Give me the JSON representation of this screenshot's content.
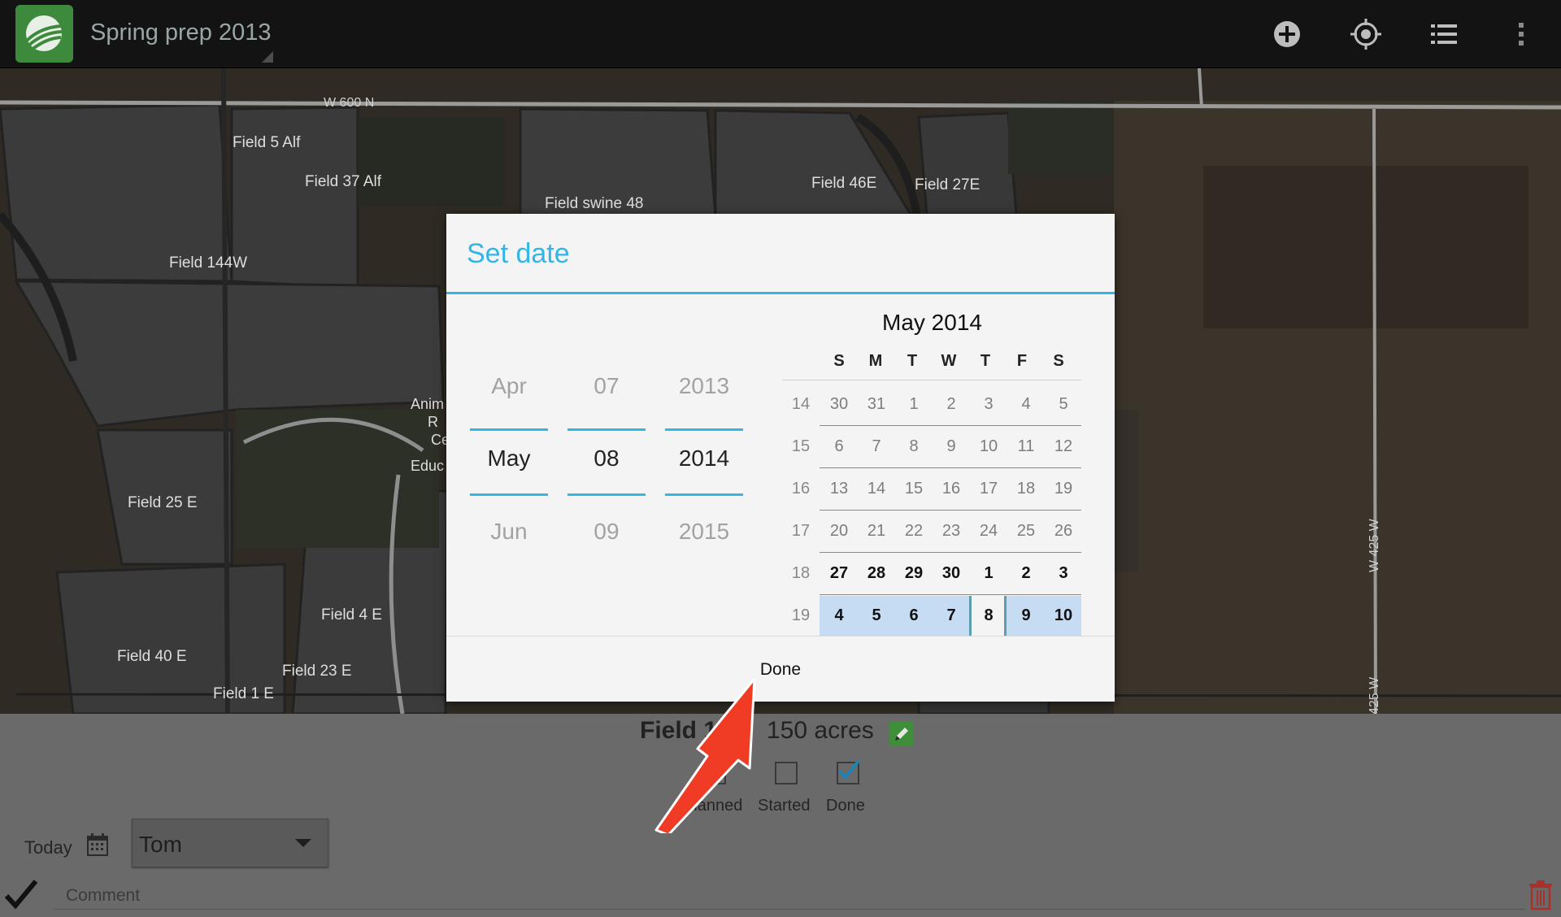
{
  "action_bar": {
    "title": "Spring prep 2013",
    "icons": [
      "logo-icon",
      "add-icon",
      "locate-icon",
      "list-icon",
      "overflow-icon"
    ]
  },
  "map": {
    "road_labels": [
      "W 600 N",
      "W 425 W",
      "425 W"
    ],
    "field_labels": [
      "Field 5 Alf",
      "Field 37 Alf",
      "Field swine 48",
      "Field 46E",
      "Field 27E",
      "Field 144W",
      "Field 25 E",
      "Field 4 E",
      "Field 40 E",
      "Field 23 E",
      "Field 1 E"
    ],
    "other_labels": [
      "Anim",
      "R",
      "Ce",
      "Educ"
    ]
  },
  "dialog": {
    "title": "Set date",
    "spinners": {
      "month": {
        "prev": "Apr",
        "current": "May",
        "next": "Jun"
      },
      "day": {
        "prev": "07",
        "current": "08",
        "next": "09"
      },
      "year": {
        "prev": "2013",
        "current": "2014",
        "next": "2015"
      }
    },
    "calendar": {
      "month_title": "May 2014",
      "weekday_headers": [
        "S",
        "M",
        "T",
        "W",
        "T",
        "F",
        "S"
      ],
      "weeks": [
        {
          "week": "14",
          "days": [
            "30",
            "31",
            "1",
            "2",
            "3",
            "4",
            "5"
          ]
        },
        {
          "week": "15",
          "days": [
            "6",
            "7",
            "8",
            "9",
            "10",
            "11",
            "12"
          ]
        },
        {
          "week": "16",
          "days": [
            "13",
            "14",
            "15",
            "16",
            "17",
            "18",
            "19"
          ]
        },
        {
          "week": "17",
          "days": [
            "20",
            "21",
            "22",
            "23",
            "24",
            "25",
            "26"
          ]
        },
        {
          "week": "18",
          "days": [
            "27",
            "28",
            "29",
            "30",
            "1",
            "2",
            "3"
          ]
        },
        {
          "week": "19",
          "days": [
            "4",
            "5",
            "6",
            "7",
            "8",
            "9",
            "10"
          ]
        }
      ],
      "selected_day": "8",
      "highlight_color": "#c6dcf3",
      "accent_color": "#33b5e5"
    },
    "done_label": "Done"
  },
  "field_panel": {
    "field_name": "Field 1 E",
    "acres": "150 acres",
    "statuses": [
      {
        "label": "Planned",
        "checked": false
      },
      {
        "label": "Started",
        "checked": false
      },
      {
        "label": "Done",
        "checked": true
      }
    ],
    "date_label": "Today",
    "assignee": "Tom",
    "comment_placeholder": "Comment"
  },
  "annotation": {
    "color": "#f03c24"
  }
}
